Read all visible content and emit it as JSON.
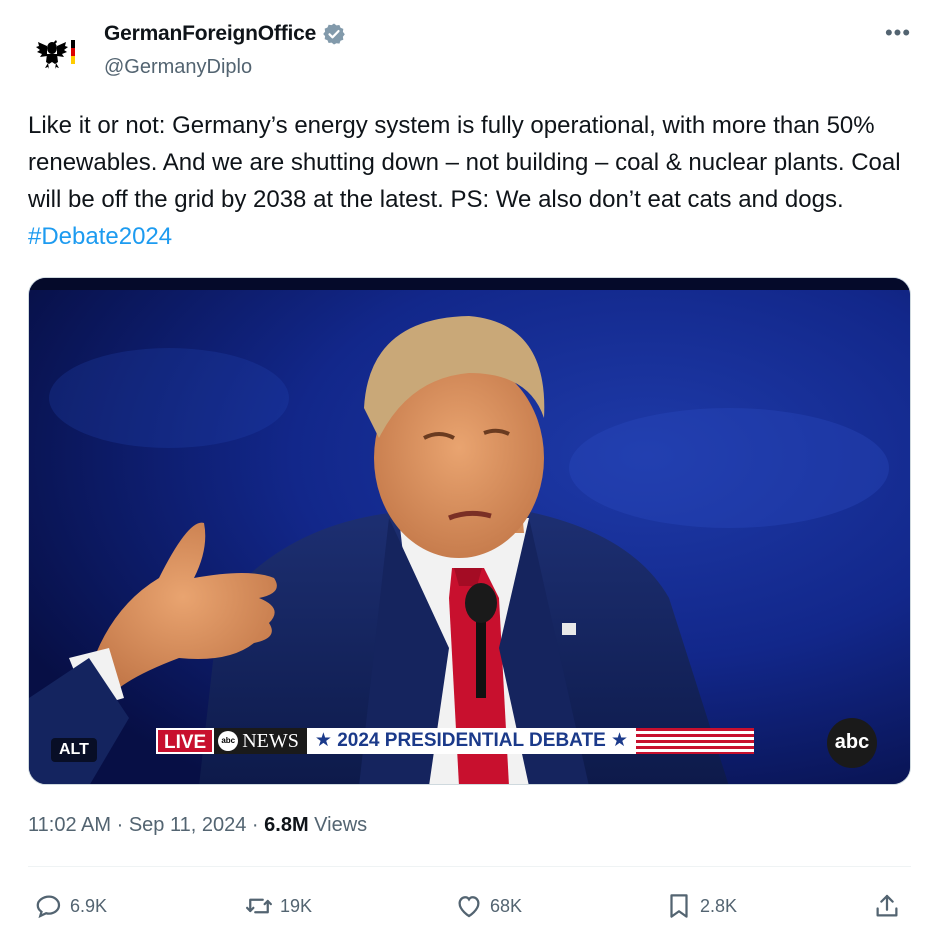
{
  "author": {
    "display_name": "GermanForeignOffice",
    "handle": "@GermanyDiplo",
    "verified": true,
    "avatar_icon": "federal-eagle-icon"
  },
  "tweet": {
    "text": "Like it or not: Germany’s energy system is fully operational, with more than 50% renewables. And we are shutting down – not building – coal & nuclear plants. Coal will be off the grid by 2038 at the latest. PS: We also don’t eat cats and dogs.",
    "hashtag": "#Debate2024"
  },
  "media": {
    "alt_label": "ALT",
    "chyron": {
      "live": "LIVE",
      "network": "NEWS",
      "network_dot": "abc",
      "headline": "★ 2024 PRESIDENTIAL DEBATE ★"
    },
    "corner_logo": "abc"
  },
  "meta": {
    "time": "11:02 AM",
    "separator": "·",
    "date": "Sep 11, 2024",
    "views_count": "6.8M",
    "views_label": "Views"
  },
  "actions": {
    "reply_count": "6.9K",
    "repost_count": "19K",
    "like_count": "68K",
    "bookmark_count": "2.8K"
  },
  "colors": {
    "text": "#0f1419",
    "secondary": "#536471",
    "link": "#1d9bf0",
    "verified_badge": "#829aab"
  }
}
